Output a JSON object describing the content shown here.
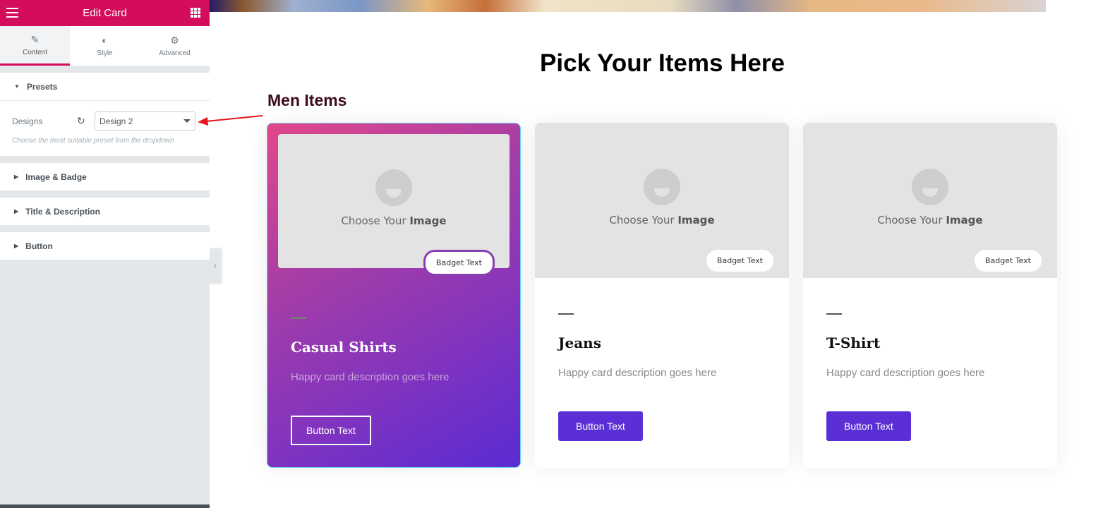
{
  "panel": {
    "title": "Edit Card",
    "tabs": [
      {
        "label": "Content",
        "icon": "pencil-icon"
      },
      {
        "label": "Style",
        "icon": "half-circle-icon"
      },
      {
        "label": "Advanced",
        "icon": "gear-icon"
      }
    ],
    "presets": {
      "title": "Presets",
      "designs_label": "Designs",
      "selected": "Design 2",
      "hint": "Choose the most suitable preset from the dropdown"
    },
    "sections": [
      "Image & Badge",
      "Title & Description",
      "Button"
    ]
  },
  "page": {
    "title": "Pick Your Items Here",
    "subtitle": "Men Items"
  },
  "cards": [
    {
      "image_text": "Choose Your",
      "image_bold": "Image",
      "badge": "Badget Text",
      "title": "Casual Shirts",
      "description": "Happy card description goes here",
      "button": "Button Text"
    },
    {
      "image_text": "Choose Your",
      "image_bold": "Image",
      "badge": "Badget Text",
      "title": "Jeans",
      "description": "Happy card description goes here",
      "button": "Button Text"
    },
    {
      "image_text": "Choose Your",
      "image_bold": "Image",
      "badge": "Badget Text",
      "title": "T-Shirt",
      "description": "Happy card description goes here",
      "button": "Button Text"
    }
  ],
  "colors": {
    "brand": "#d30c5c",
    "button": "#5a2fd6",
    "annotation_arrow": "#e8141c"
  }
}
